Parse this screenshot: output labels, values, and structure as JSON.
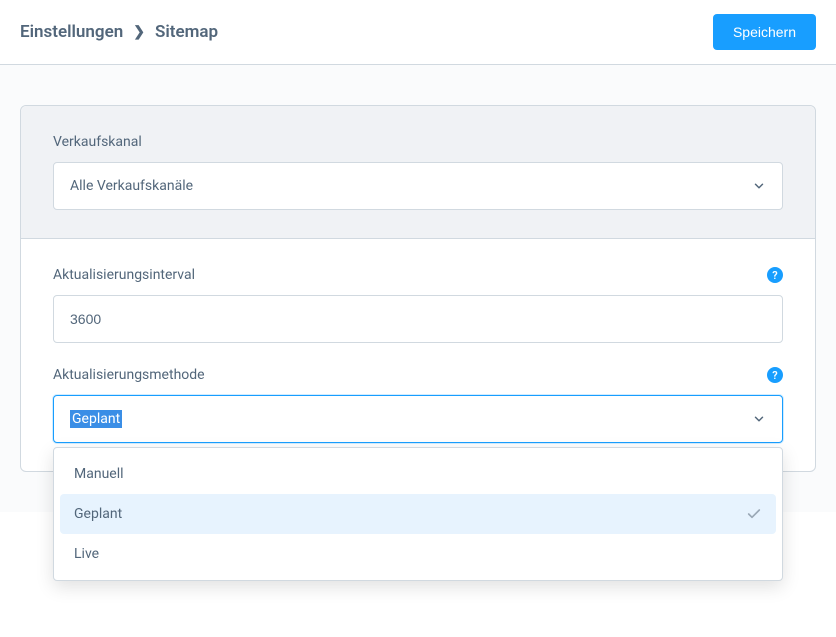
{
  "header": {
    "breadcrumb_root": "Einstellungen",
    "breadcrumb_current": "Sitemap",
    "save_label": "Speichern"
  },
  "salesChannel": {
    "label": "Verkaufskanal",
    "value": "Alle Verkaufskanäle"
  },
  "refreshInterval": {
    "label": "Aktualisierungsinterval",
    "value": "3600"
  },
  "refreshMethod": {
    "label": "Aktualisierungsmethode",
    "value": "Geplant",
    "options": [
      {
        "label": "Manuell",
        "selected": false
      },
      {
        "label": "Geplant",
        "selected": true
      },
      {
        "label": "Live",
        "selected": false
      }
    ]
  }
}
